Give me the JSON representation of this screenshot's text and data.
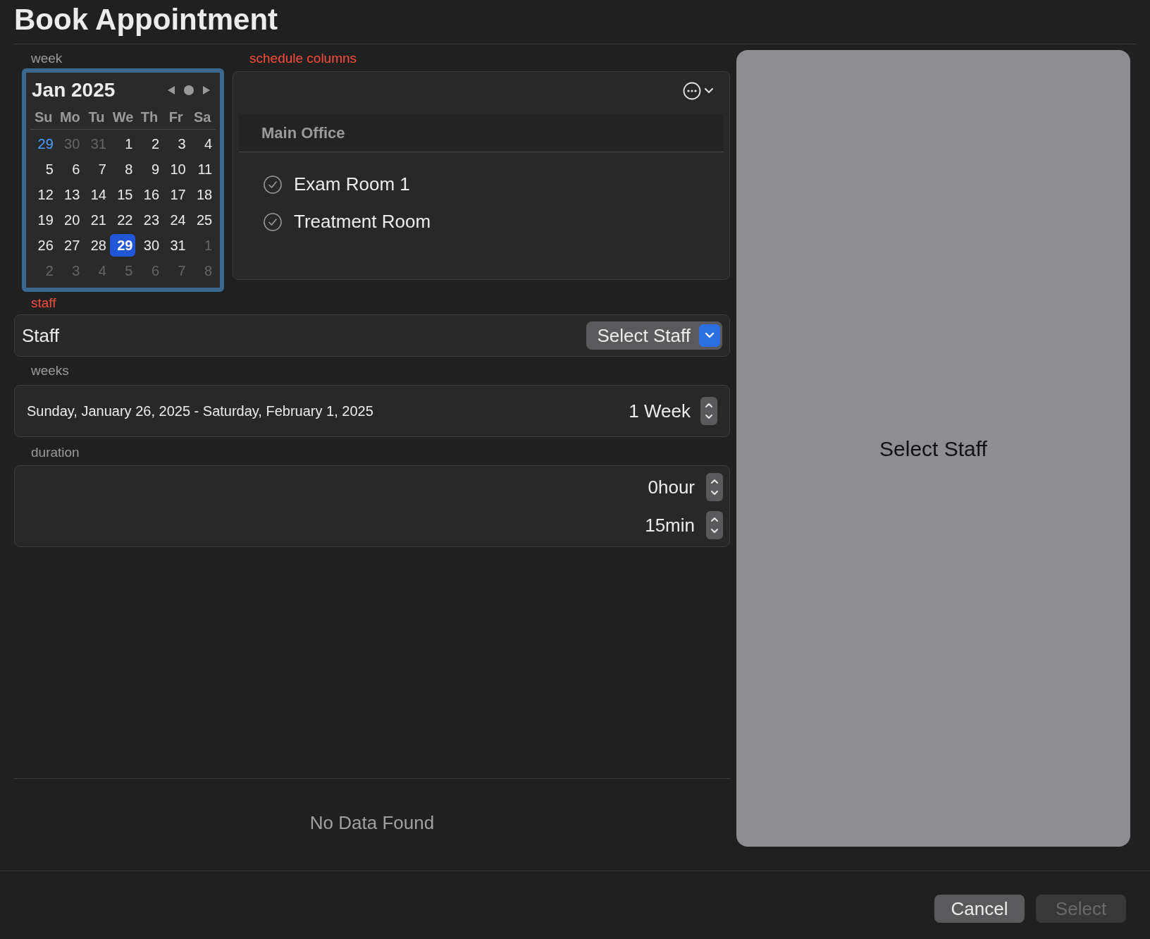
{
  "title": "Book Appointment",
  "week": {
    "label": "week",
    "month": "Jan 2025",
    "weekdays": [
      "Su",
      "Mo",
      "Tu",
      "We",
      "Th",
      "Fr",
      "Sa"
    ],
    "days": [
      {
        "day": "29",
        "kind": "accent",
        "selected": false
      },
      {
        "day": "30",
        "kind": "other",
        "selected": false
      },
      {
        "day": "31",
        "kind": "other",
        "selected": false
      },
      {
        "day": "1",
        "kind": "current",
        "selected": false
      },
      {
        "day": "2",
        "kind": "current",
        "selected": false
      },
      {
        "day": "3",
        "kind": "current",
        "selected": false
      },
      {
        "day": "4",
        "kind": "current",
        "selected": false
      },
      {
        "day": "5",
        "kind": "current",
        "selected": false
      },
      {
        "day": "6",
        "kind": "current",
        "selected": false
      },
      {
        "day": "7",
        "kind": "current",
        "selected": false
      },
      {
        "day": "8",
        "kind": "current",
        "selected": false
      },
      {
        "day": "9",
        "kind": "current",
        "selected": false
      },
      {
        "day": "10",
        "kind": "current",
        "selected": false
      },
      {
        "day": "11",
        "kind": "current",
        "selected": false
      },
      {
        "day": "12",
        "kind": "current",
        "selected": false
      },
      {
        "day": "13",
        "kind": "current",
        "selected": false
      },
      {
        "day": "14",
        "kind": "current",
        "selected": false
      },
      {
        "day": "15",
        "kind": "current",
        "selected": false
      },
      {
        "day": "16",
        "kind": "current",
        "selected": false
      },
      {
        "day": "17",
        "kind": "current",
        "selected": false
      },
      {
        "day": "18",
        "kind": "current",
        "selected": false
      },
      {
        "day": "19",
        "kind": "current",
        "selected": false
      },
      {
        "day": "20",
        "kind": "current",
        "selected": false
      },
      {
        "day": "21",
        "kind": "current",
        "selected": false
      },
      {
        "day": "22",
        "kind": "current",
        "selected": false
      },
      {
        "day": "23",
        "kind": "current",
        "selected": false
      },
      {
        "day": "24",
        "kind": "current",
        "selected": false
      },
      {
        "day": "25",
        "kind": "current",
        "selected": false
      },
      {
        "day": "26",
        "kind": "current",
        "selected": false
      },
      {
        "day": "27",
        "kind": "current",
        "selected": false
      },
      {
        "day": "28",
        "kind": "current",
        "selected": false
      },
      {
        "day": "29",
        "kind": "current",
        "selected": true
      },
      {
        "day": "30",
        "kind": "current",
        "selected": false
      },
      {
        "day": "31",
        "kind": "current",
        "selected": false
      },
      {
        "day": "1",
        "kind": "other",
        "selected": false
      },
      {
        "day": "2",
        "kind": "other",
        "selected": false
      },
      {
        "day": "3",
        "kind": "other",
        "selected": false
      },
      {
        "day": "4",
        "kind": "other",
        "selected": false
      },
      {
        "day": "5",
        "kind": "other",
        "selected": false
      },
      {
        "day": "6",
        "kind": "other",
        "selected": false
      },
      {
        "day": "7",
        "kind": "other",
        "selected": false
      },
      {
        "day": "8",
        "kind": "other",
        "selected": false
      }
    ]
  },
  "schedule_columns": {
    "label": "schedule columns",
    "group": "Main Office",
    "rooms": [
      {
        "name": "Exam Room 1",
        "checked": true
      },
      {
        "name": "Treatment Room",
        "checked": true
      }
    ]
  },
  "staff": {
    "label": "staff",
    "field_label": "Staff",
    "button": "Select Staff"
  },
  "weeks": {
    "label": "weeks",
    "range": "Sunday, January 26, 2025 - Saturday, February 1, 2025",
    "value": "1 Week"
  },
  "duration": {
    "label": "duration",
    "values": [
      "0hour",
      "15min"
    ]
  },
  "results": {
    "empty": "No Data Found"
  },
  "side_panel": {
    "message": "Select Staff"
  },
  "buttons": [
    {
      "label": "Cancel",
      "disabled": false
    },
    {
      "label": "Select",
      "disabled": true
    }
  ]
}
